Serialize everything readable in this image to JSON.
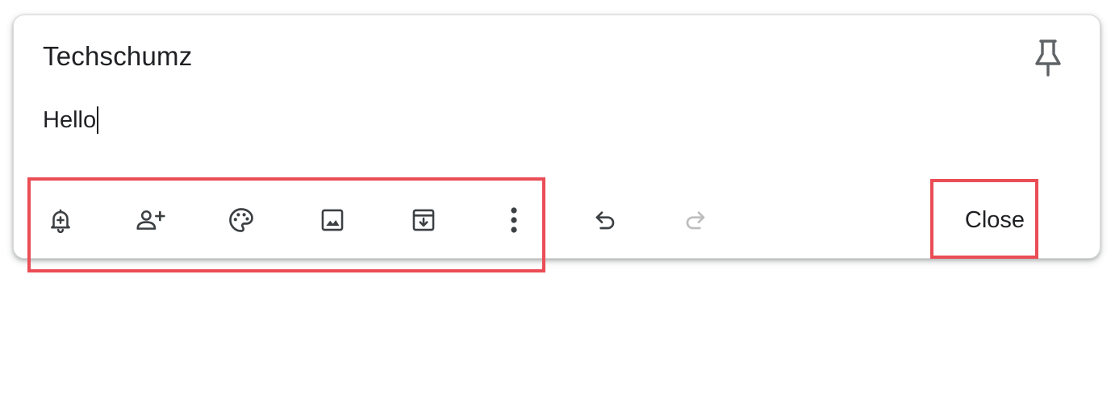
{
  "note": {
    "title": "Techschumz",
    "body": "Hello"
  },
  "header": {
    "pin_icon": "pin-icon"
  },
  "toolbar": {
    "buttons": [
      {
        "icon": "bell-plus-icon",
        "action": "remind-me"
      },
      {
        "icon": "person-add-icon",
        "action": "collaborator"
      },
      {
        "icon": "palette-icon",
        "action": "background-options"
      },
      {
        "icon": "image-icon",
        "action": "add-image"
      },
      {
        "icon": "archive-icon",
        "action": "archive"
      },
      {
        "icon": "more-vert-icon",
        "action": "more"
      },
      {
        "icon": "undo-icon",
        "action": "undo",
        "enabled": true
      },
      {
        "icon": "redo-icon",
        "action": "redo",
        "enabled": false
      }
    ],
    "close_label": "Close"
  },
  "colors": {
    "icon": "#3c4043",
    "icon_disabled": "#bdbdbd",
    "text": "#202124",
    "highlight": "#ea4d55"
  }
}
